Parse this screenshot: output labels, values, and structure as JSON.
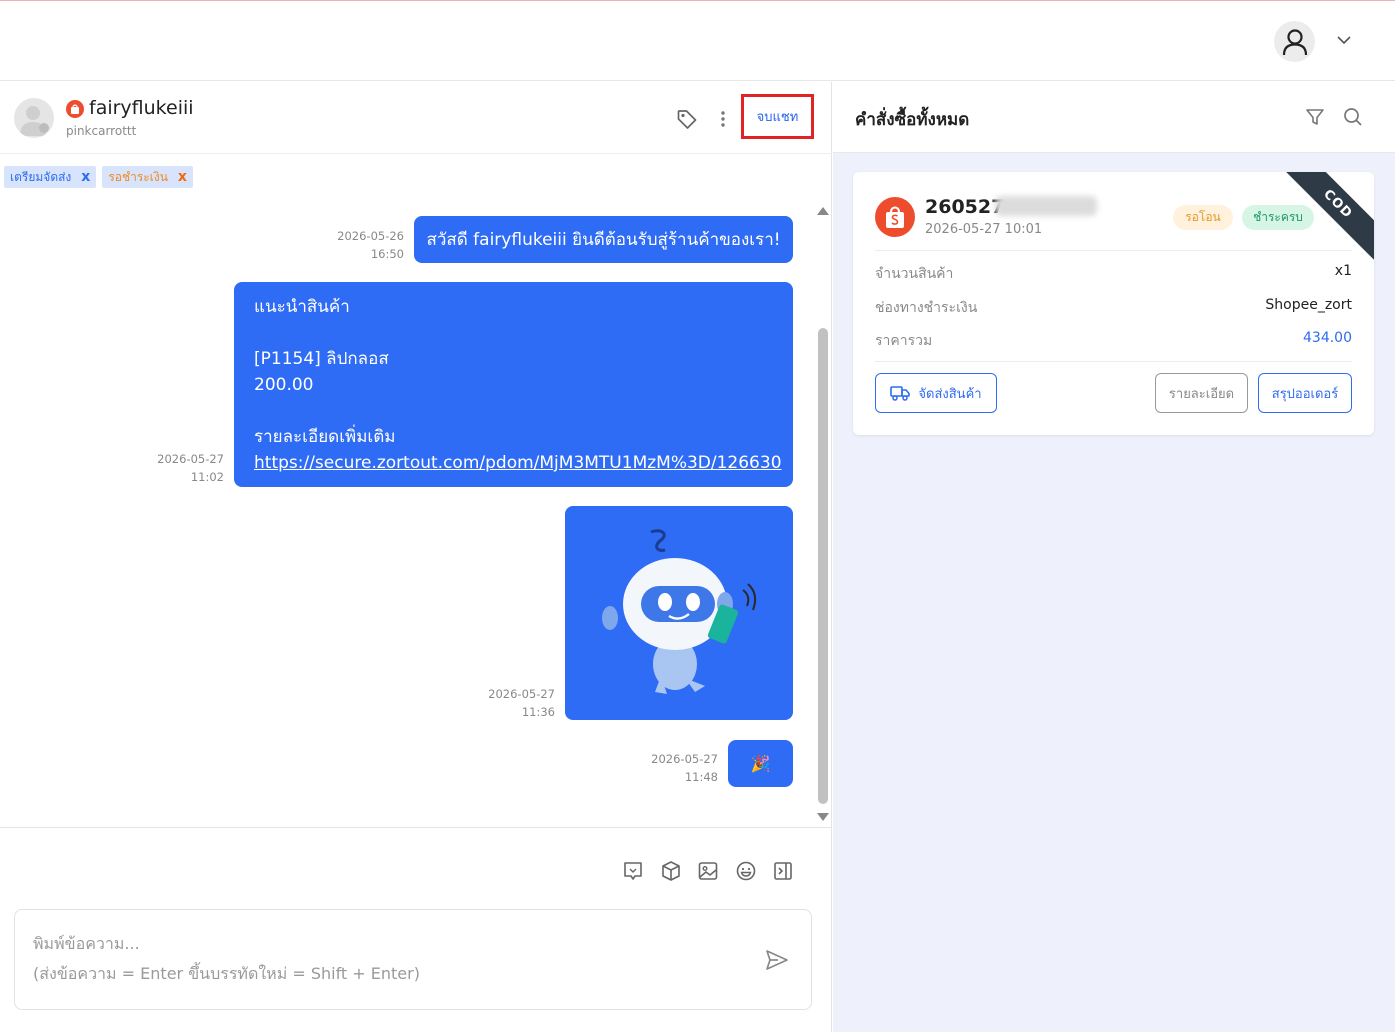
{
  "header": {
    "user_icon": "user-icon",
    "chevron_icon": "chevron-down-icon"
  },
  "chat": {
    "customer_name": "fairyflukeiii",
    "customer_sub": "pinkcarrottt",
    "end_chat_label": "จบแชท",
    "tags": [
      {
        "label": "เตรียมจัดส่ง",
        "remove": "x",
        "color": "#2f6cf0"
      },
      {
        "label": "รอชำระเงิน",
        "remove": "x",
        "color": "#f08a24"
      }
    ],
    "messages": [
      {
        "date": "2026-05-26",
        "time": "16:50",
        "text": "สวัสดี fairyflukeiii ยินดีต้อนรับสู่ร้านค้าของเรา!"
      },
      {
        "date": "2026-05-27",
        "time": "11:02",
        "lines": [
          "แนะนำสินค้า",
          "",
          "[P1154] ลิปกลอส",
          "200.00",
          "",
          "รายละเอียดเพิ่มเติม"
        ],
        "link": "https://secure.zortout.com/pdom/MjM3MTU1MzM%3D/126630"
      },
      {
        "date": "2026-05-27",
        "time": "11:36",
        "image": "robot-sticker"
      },
      {
        "date": "2026-05-27",
        "time": "11:48",
        "text": "🎉"
      }
    ],
    "composer": {
      "placeholder_line1": "พิมพ์ข้อความ...",
      "placeholder_line2": "(ส่งข้อความ = Enter ขึ้นบรรทัดใหม่ = Shift + Enter)"
    },
    "bubble_color": "#2f6cf5"
  },
  "orders": {
    "title": "คำสั่งซื้อทั้งหมด",
    "card": {
      "order_id": "260527",
      "time": "2026-05-27 10:01",
      "status_wait": "รอโอน",
      "status_paid": "ชำระครบ",
      "ribbon": "COD",
      "rows": [
        {
          "label": "จำนวนสินค้า",
          "value": "x1"
        },
        {
          "label": "ช่องทางชำระเงิน",
          "value": "Shopee_zort"
        },
        {
          "label": "ราคารวม",
          "value": "434.00"
        }
      ],
      "ship_button": "จัดส่งสินค้า",
      "detail_button": "รายละเอียด",
      "summary_button": "สรุปออเดอร์"
    }
  }
}
